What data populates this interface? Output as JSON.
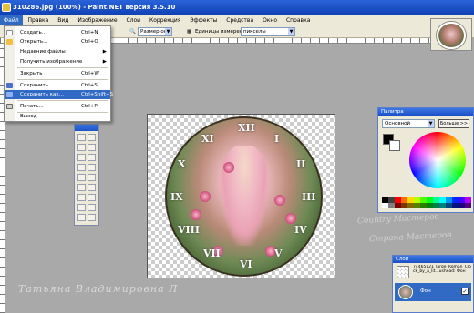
{
  "window": {
    "title": "310286.jpg (100%) - Paint.NET версия 3.5.10"
  },
  "menubar": [
    "Файл",
    "Правка",
    "Вид",
    "Изображение",
    "Слои",
    "Коррекция",
    "Эффекты",
    "Средства",
    "Окно",
    "Справка"
  ],
  "toolbar": {
    "size_label": "Размер окн",
    "units_label": "Единицы измерения:",
    "units_value": "пикселы"
  },
  "file_menu": [
    {
      "label": "Создать...",
      "shortcut": "Ctrl+N"
    },
    {
      "label": "Открыть...",
      "shortcut": "Ctrl+O"
    },
    {
      "label": "Недавние файлы",
      "submenu": "▶"
    },
    {
      "label": "Получить изображение",
      "submenu": "▶"
    },
    {
      "label": "Закрыть",
      "shortcut": "Ctrl+W"
    },
    {
      "label": "Сохранить",
      "shortcut": "Ctrl+S"
    },
    {
      "label": "Сохранить как...",
      "shortcut": "Ctrl+Shift+S",
      "selected": true
    },
    {
      "label": "Печать...",
      "shortcut": "Ctrl+P"
    },
    {
      "label": "Выход"
    }
  ],
  "clock_numerals": [
    "XII",
    "I",
    "II",
    "III",
    "IV",
    "V",
    "VI",
    "VII",
    "VIII",
    "IX",
    "X",
    "XI"
  ],
  "palette": {
    "title": "Палитра",
    "mode": "Основной",
    "more_button": "Больше >>"
  },
  "layers": {
    "title": "Слои",
    "layer_name": "Фон",
    "file_caption": "74465121_large_Roman_Clock_by_a_lit...ushead: Фон"
  },
  "signature": "Татьяна Владимировна Л",
  "watermarks": [
    "Country Мастеров",
    "Страна Мастеров"
  ],
  "colors": {
    "accent": "#316ac5",
    "titlebar": "#0f3fb3",
    "workspace": "#a9a9a9"
  }
}
